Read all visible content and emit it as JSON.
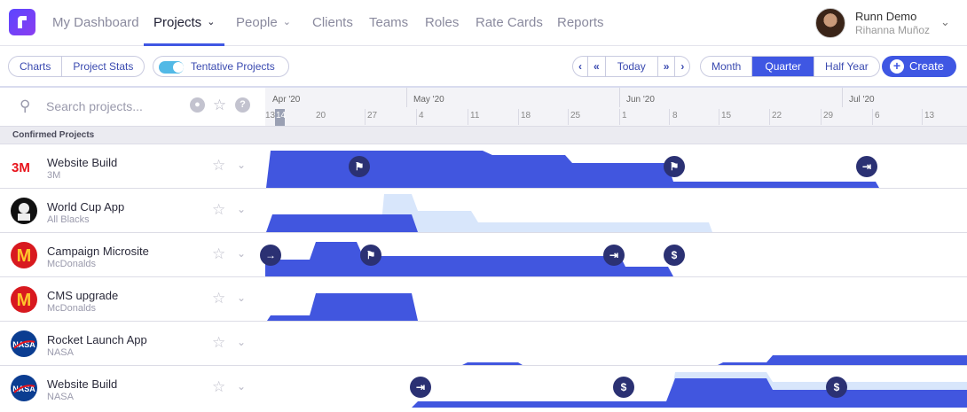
{
  "app": {
    "nav": [
      "My Dashboard",
      "Projects",
      "People",
      "Clients",
      "Teams",
      "Roles",
      "Rate Cards",
      "Reports"
    ],
    "user_name": "Runn Demo",
    "user_org": "Rihanna Muñoz"
  },
  "toolbar": {
    "view_tabs": [
      "Charts",
      "Project Stats"
    ],
    "tentative_label": "Tentative Projects",
    "tentative_on": true,
    "today_label": "Today",
    "range_tabs": [
      "Month",
      "Quarter",
      "Half Year"
    ],
    "selected_range": "Quarter",
    "create_label": "Create"
  },
  "search": {
    "placeholder": "Search projects..."
  },
  "timeline": {
    "months": [
      "Apr '20",
      "May '20",
      "Jun '20",
      "Jul '20"
    ],
    "weeks": [
      "13",
      "14",
      "20",
      "27",
      "4",
      "11",
      "18",
      "25",
      "1",
      "8",
      "15",
      "22",
      "29",
      "6",
      "13"
    ]
  },
  "section_label": "Confirmed Projects",
  "projects": [
    {
      "name": "Website Build",
      "client": "3M",
      "logo": "3M"
    },
    {
      "name": "World Cup App",
      "client": "All Blacks",
      "logo": "all-blacks"
    },
    {
      "name": "Campaign Microsite",
      "client": "McDonalds",
      "logo": "mcdonalds"
    },
    {
      "name": "CMS upgrade",
      "client": "McDonalds",
      "logo": "mcdonalds"
    },
    {
      "name": "Rocket Launch App",
      "client": "NASA",
      "logo": "nasa"
    },
    {
      "name": "Website Build",
      "client": "NASA",
      "logo": "nasa"
    }
  ],
  "colors": {
    "accent": "#3f57e3",
    "bar": "#4156df",
    "tentative": "#d8e6fb",
    "marker": "#2b3173"
  },
  "icons": {
    "flag": "flag-icon",
    "end": "end-arrow-icon",
    "start": "start-arrow-icon",
    "money": "dollar-icon"
  }
}
